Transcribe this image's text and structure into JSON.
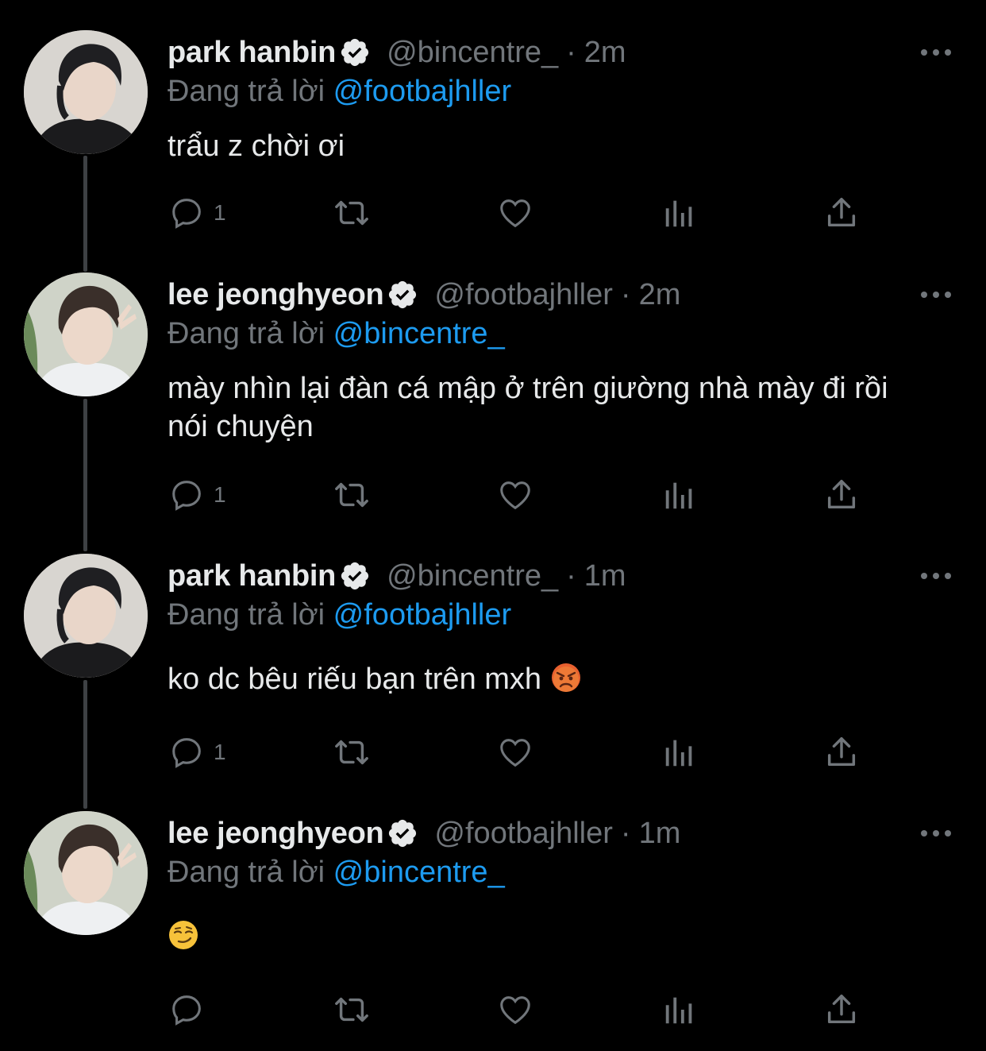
{
  "colors": {
    "background": "#000000",
    "text_primary": "#e7e9ea",
    "text_secondary": "#71767b",
    "accent": "#1d9bf0",
    "thread_line": "#3e4144"
  },
  "tweets": [
    {
      "display_name": "park hanbin",
      "handle": "@bincentre_",
      "separator": "·",
      "time": "2m",
      "replying_prefix": "Đang trả lời",
      "replying_to": "@footbajhller",
      "text": "trẩu z chời ơi",
      "reply_count": "1"
    },
    {
      "display_name": "lee jeonghyeon",
      "handle": "@footbajhller",
      "separator": "·",
      "time": "2m",
      "replying_prefix": "Đang trả lời",
      "replying_to": "@bincentre_",
      "text": "mày nhìn lại đàn cá mập ở trên giường nhà mày đi rồi nói chuyện",
      "reply_count": "1"
    },
    {
      "display_name": "park hanbin",
      "handle": "@bincentre_",
      "separator": "·",
      "time": "1m",
      "replying_prefix": "Đang trả lời",
      "replying_to": "@footbajhller",
      "text": "ko dc bêu riếu bạn trên mxh",
      "emoji": "angry-face-emoji",
      "reply_count": "1"
    },
    {
      "display_name": "lee jeonghyeon",
      "handle": "@footbajhller",
      "separator": "·",
      "time": "1m",
      "replying_prefix": "Đang trả lời",
      "replying_to": "@bincentre_",
      "text": "",
      "emoji": "smirking-face-emoji",
      "reply_count": ""
    }
  ],
  "icons": {
    "verified": "verified-badge-icon",
    "more": "more-options-icon",
    "reply": "reply-icon",
    "retweet": "retweet-icon",
    "like": "like-icon",
    "views": "views-icon",
    "share": "share-icon"
  }
}
